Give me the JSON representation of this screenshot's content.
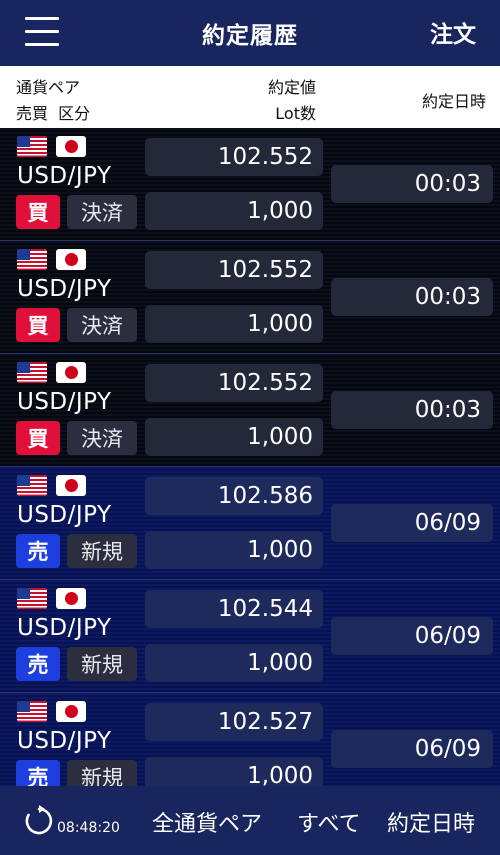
{
  "header": {
    "title": "約定履歴",
    "order_label": "注文",
    "menu_icon": "hamburger-menu-icon"
  },
  "columns": {
    "pair": "通貨ペア",
    "side_kind": "売買  区分",
    "rate": "約定値",
    "lot": "Lot数",
    "datetime": "約定日時"
  },
  "rows": [
    {
      "pair": "USD/JPY",
      "side": "買",
      "side_type": "buy",
      "kind": "決済",
      "rate": "102.552",
      "lot": "1,000",
      "datetime": "00:03"
    },
    {
      "pair": "USD/JPY",
      "side": "買",
      "side_type": "buy",
      "kind": "決済",
      "rate": "102.552",
      "lot": "1,000",
      "datetime": "00:03"
    },
    {
      "pair": "USD/JPY",
      "side": "買",
      "side_type": "buy",
      "kind": "決済",
      "rate": "102.552",
      "lot": "1,000",
      "datetime": "00:03"
    },
    {
      "pair": "USD/JPY",
      "side": "売",
      "side_type": "sell",
      "kind": "新規",
      "rate": "102.586",
      "lot": "1,000",
      "datetime": "06/09"
    },
    {
      "pair": "USD/JPY",
      "side": "売",
      "side_type": "sell",
      "kind": "新規",
      "rate": "102.544",
      "lot": "1,000",
      "datetime": "06/09"
    },
    {
      "pair": "USD/JPY",
      "side": "売",
      "side_type": "sell",
      "kind": "新規",
      "rate": "102.527",
      "lot": "1,000",
      "datetime": "06/09"
    }
  ],
  "footer": {
    "time": "08:48:20",
    "pair_filter": "全通貨ペア",
    "all_filter": "すべて",
    "sort_label": "約定日時",
    "refresh_icon": "refresh-icon"
  },
  "colors": {
    "header_bg": "#18255e",
    "buy": "#e0103a",
    "sell": "#1d3fe0"
  }
}
